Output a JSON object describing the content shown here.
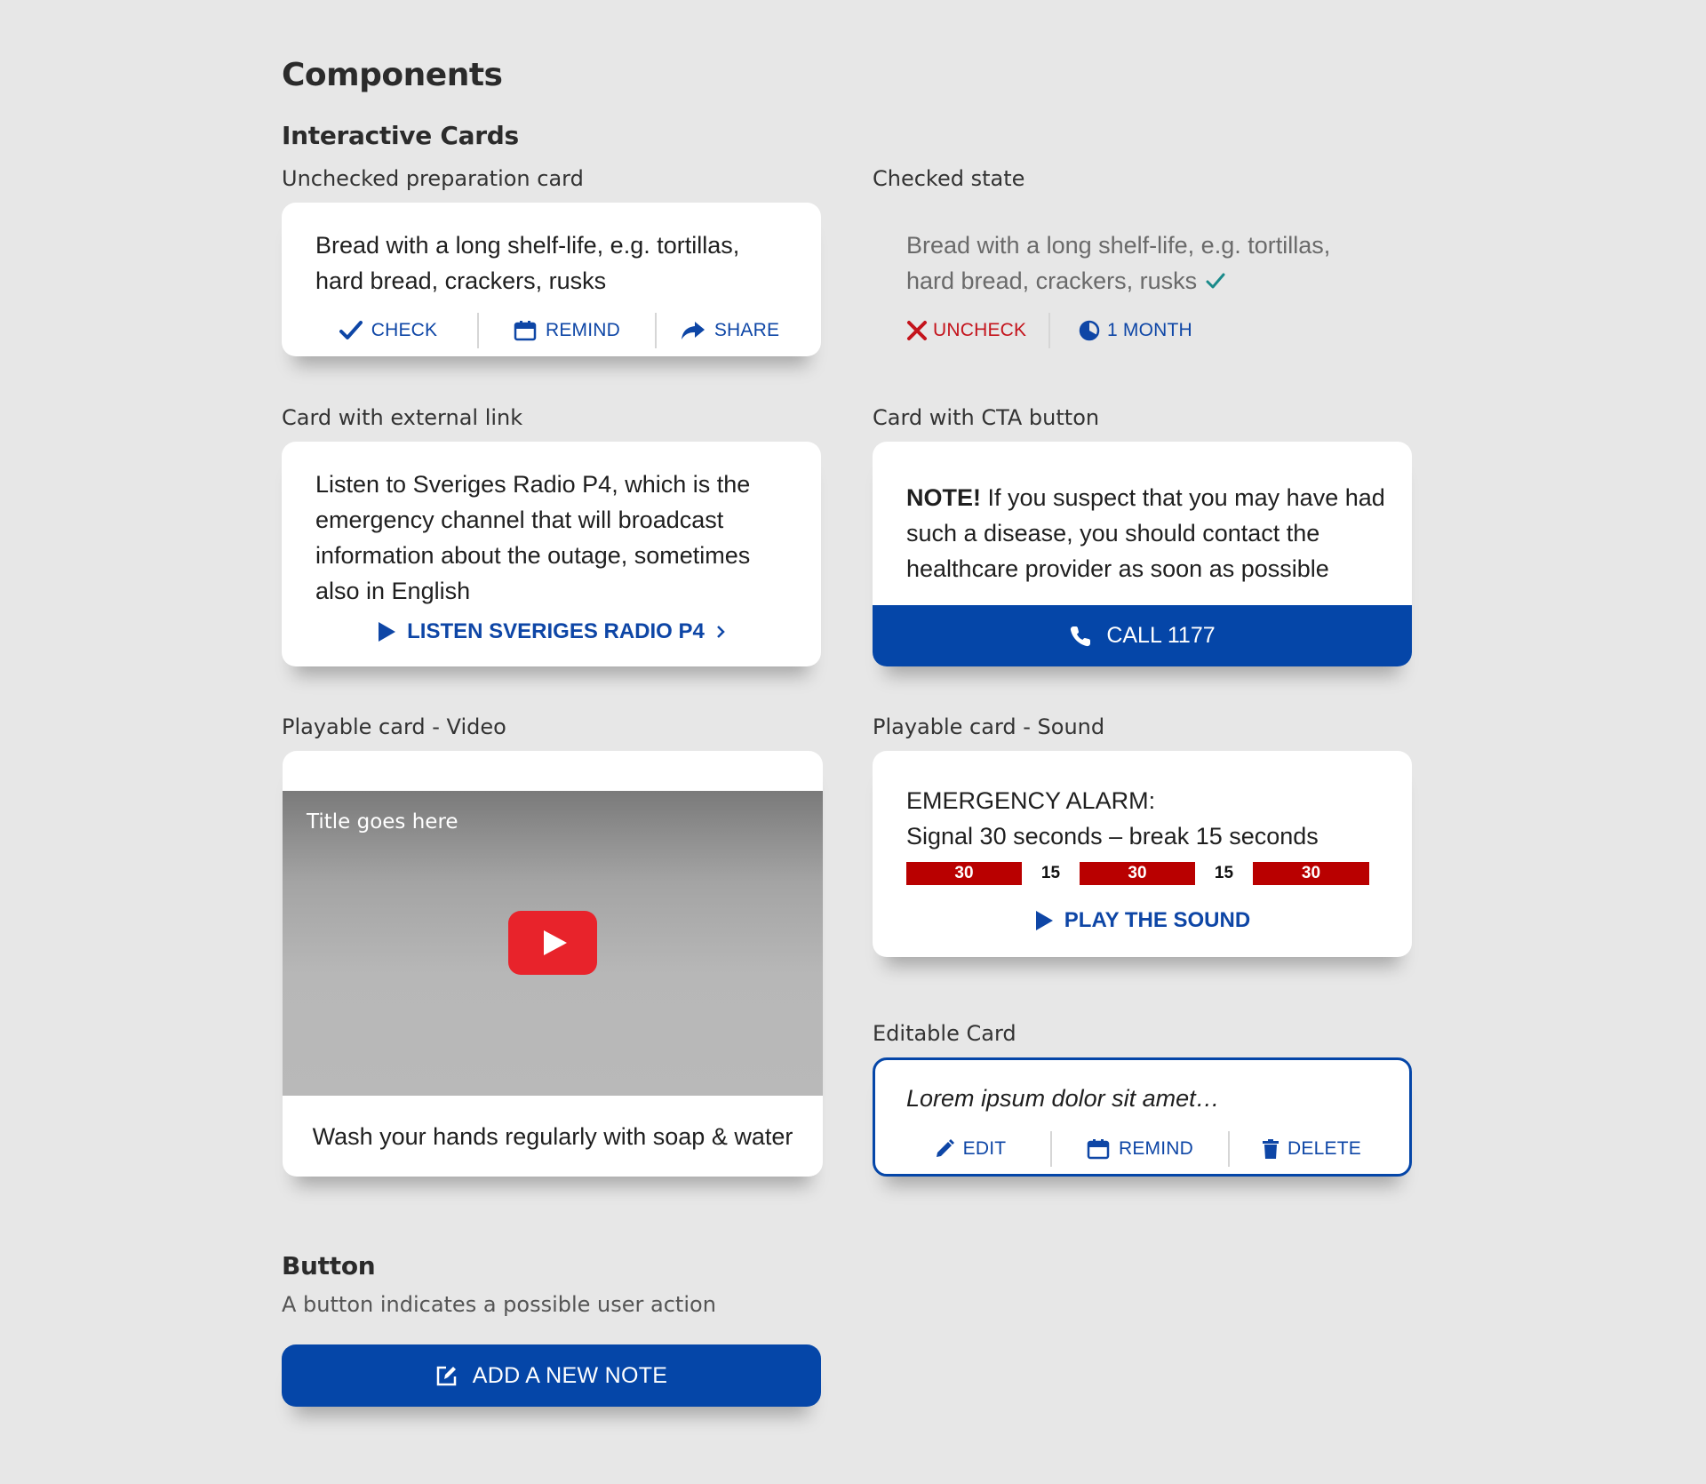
{
  "page": {
    "title": "Components",
    "subtitle": "Interactive Cards"
  },
  "colors": {
    "brand_blue": "#0546a8",
    "link_blue": "#0e46a6",
    "alarm_red": "#b90000",
    "check_teal": "#1a8a8a",
    "uncheck_red": "#c4141c"
  },
  "unchecked_card": {
    "label": "Unchecked preparation card",
    "text_line1": "Bread with a long shelf-life, e.g. tortillas,",
    "text_line2": "hard bread, crackers, rusks",
    "actions": [
      {
        "label": "CHECK",
        "icon": "check-icon"
      },
      {
        "label": "REMIND",
        "icon": "calendar-icon"
      },
      {
        "label": "SHARE",
        "icon": "share-icon"
      }
    ]
  },
  "checked_card": {
    "label": "Checked state",
    "text_line1": "Bread with a long shelf-life, e.g. tortillas,",
    "text_line2": "hard bread, crackers, rusks",
    "actions": [
      {
        "label": "UNCHECK",
        "icon": "x-icon"
      },
      {
        "label": "1 MONTH",
        "icon": "pie-clock-icon"
      }
    ]
  },
  "external_link_card": {
    "label": "Card with external link",
    "lines": [
      "Listen to Sveriges Radio P4, which is the",
      "emergency channel that will broadcast",
      "information about the outage, sometimes",
      "also in English"
    ],
    "link_label": "LISTEN SVERIGES RADIO P4"
  },
  "cta_card": {
    "label": "Card with CTA button",
    "note_bold": "NOTE!",
    "line1_rest": " If you suspect that you may have had",
    "line2": "such a disease, you should contact the",
    "line3": "healthcare provider as soon as possible",
    "button_label": "CALL 1177"
  },
  "video_card": {
    "label": "Playable card - Video",
    "video_title": "Title goes here",
    "caption": "Wash your hands regularly with soap & water"
  },
  "sound_card": {
    "label": "Playable card - Sound",
    "line1": "EMERGENCY ALARM:",
    "line2": "Signal 30 seconds – break 15 seconds",
    "timeline": [
      "30",
      "15",
      "30",
      "15",
      "30"
    ],
    "play_label": "PLAY THE SOUND"
  },
  "editable_card": {
    "label": "Editable Card",
    "text": "Lorem ipsum dolor sit amet…",
    "actions": [
      {
        "label": "EDIT",
        "icon": "pencil-icon"
      },
      {
        "label": "REMIND",
        "icon": "calendar-icon"
      },
      {
        "label": "DELETE",
        "icon": "trash-icon"
      }
    ]
  },
  "button_section": {
    "title": "Button",
    "description": "A button indicates a possible user action",
    "button_label": "ADD A NEW NOTE"
  }
}
